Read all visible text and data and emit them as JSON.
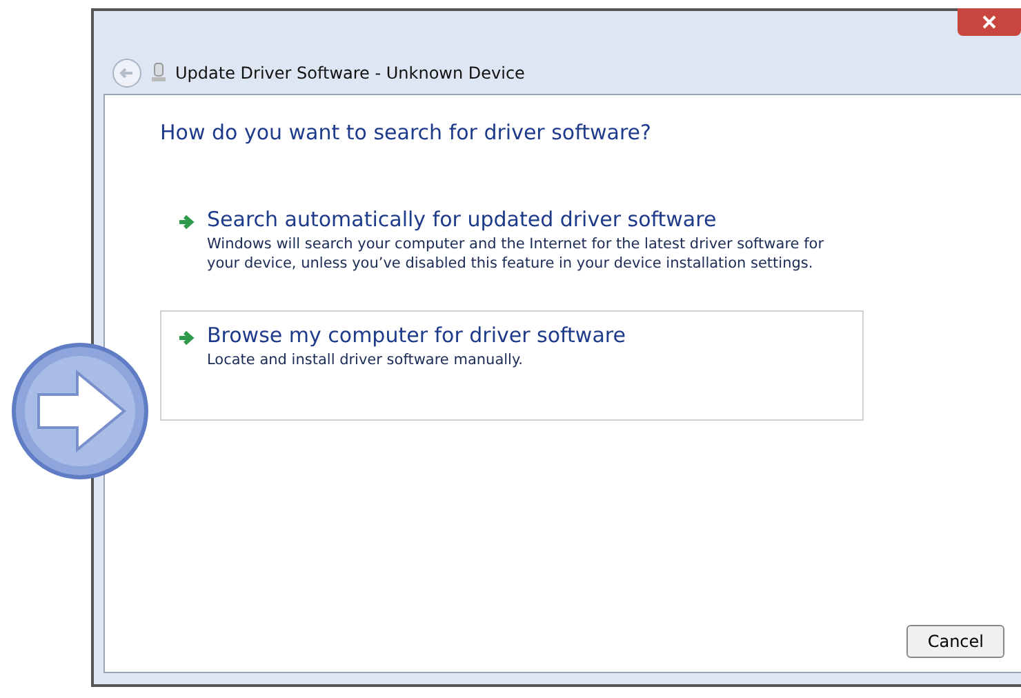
{
  "window": {
    "title": "Update Driver Software - Unknown Device"
  },
  "heading": "How do you want to search for driver software?",
  "options": [
    {
      "title": "Search automatically for updated driver software",
      "description": "Windows will search your computer and the Internet for the latest driver software for your device, unless you’ve disabled this feature in your device installation settings.",
      "selected": false
    },
    {
      "title": "Browse my computer for driver software",
      "description": "Locate and install driver software manually.",
      "selected": true
    }
  ],
  "buttons": [
    "Cancel"
  ]
}
